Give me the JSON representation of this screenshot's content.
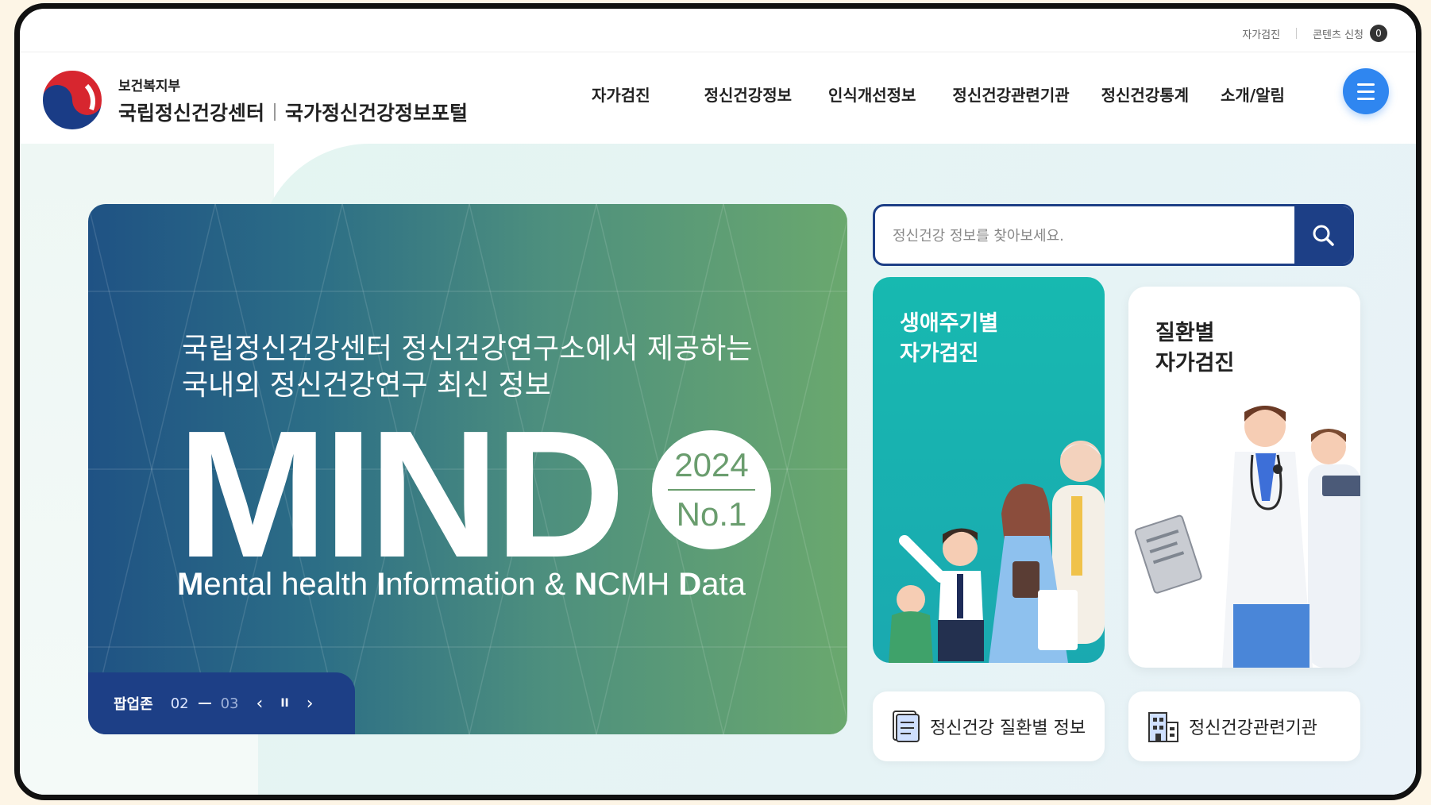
{
  "utility": {
    "self_check": "자가검진",
    "content_request": "콘텐츠 신청",
    "content_icon": "0"
  },
  "header": {
    "ministry": "보건복지부",
    "org_primary": "국립정신건강센터",
    "org_secondary": "국가정신건강정보포털",
    "logo_icon": "taegeuk-logo-icon",
    "nav": [
      "자가검진",
      "정신건강정보",
      "인식개선정보",
      "정신건강관련기관",
      "정신건강통계",
      "소개/알림"
    ],
    "menu_icon": "hamburger-icon"
  },
  "banner": {
    "subtitle_line1": "국립정신건강센터 정신건강연구소에서 제공하는",
    "subtitle_line2": "국내외 정신건강연구 최신 정보",
    "title": "MIND",
    "badge_year": "2024",
    "badge_no": "No.1",
    "tagline_parts": [
      {
        "b": "M",
        "t": "ental health "
      },
      {
        "b": "I",
        "t": "nformation & "
      },
      {
        "b": "N",
        "t": "CMH "
      },
      {
        "b": "D",
        "t": "ata"
      }
    ],
    "colors": {
      "start": "#1f5284",
      "end": "#6aa86e",
      "control_bg": "#1d3f86"
    }
  },
  "popup_zone": {
    "label": "팝업존",
    "current": "02",
    "total": "03",
    "prev": "‹",
    "pause": "II",
    "next": "›"
  },
  "search": {
    "placeholder": "정신건강 정보를 찾아보세요.",
    "icon": "search-icon"
  },
  "cards": {
    "lifecycle": {
      "line1": "생애주기별",
      "line2": "자가검진",
      "bg": "#17b9b0"
    },
    "disease": {
      "line1": "질환별",
      "line2": "자가검진"
    }
  },
  "quick_links": {
    "disease_info": {
      "label": "정신건강 질환별 정보",
      "icon": "document-icon"
    },
    "institutions": {
      "label": "정신건강관련기관",
      "icon": "building-icon"
    }
  }
}
